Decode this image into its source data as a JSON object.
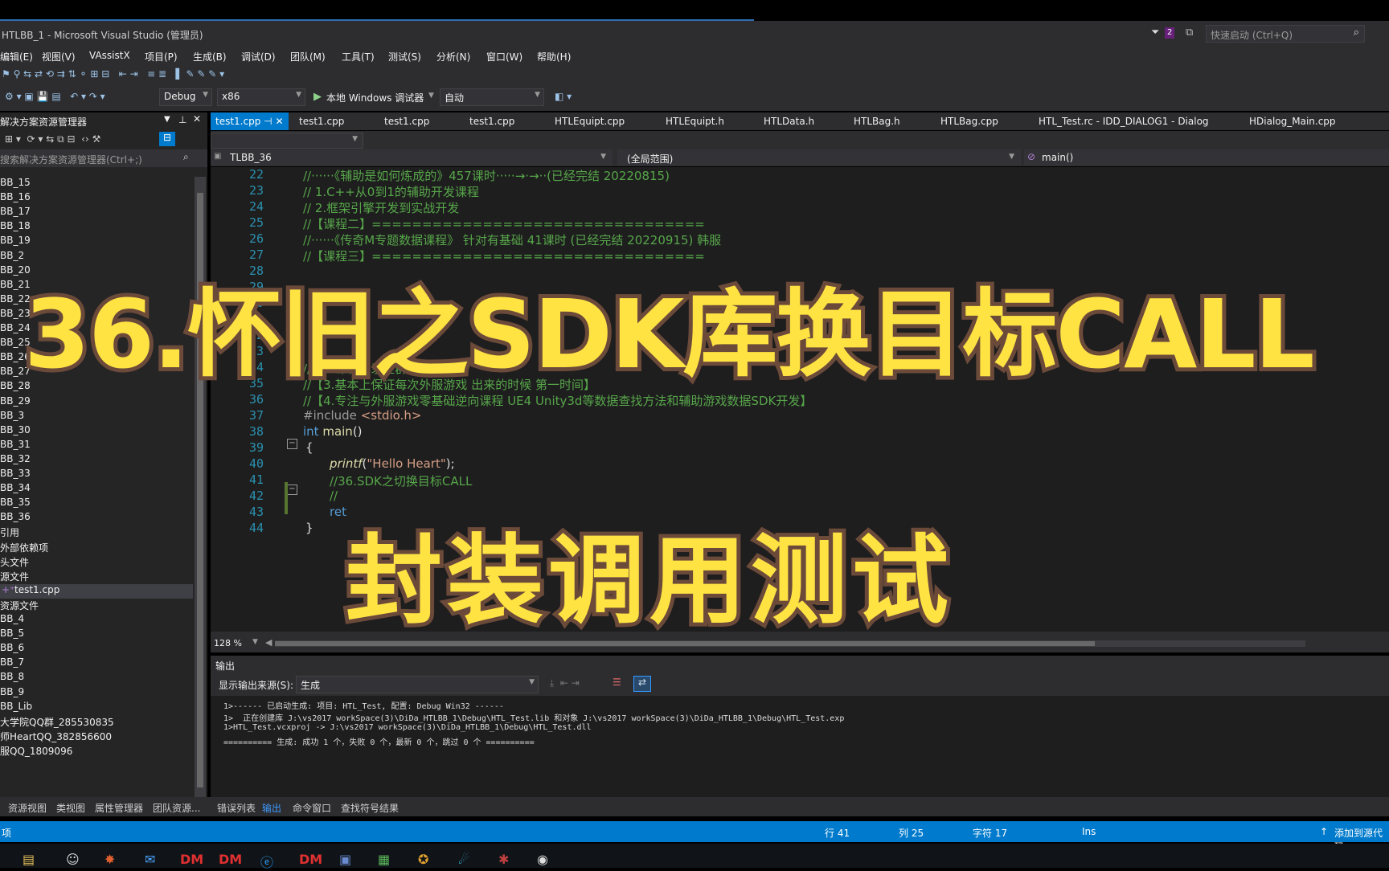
{
  "window": {
    "title": "HTLBB_1 - Microsoft Visual Studio (管理员)",
    "filter_count": "2",
    "quick_launch_placeholder": "快速启动 (Ctrl+Q)"
  },
  "menu": [
    "编辑(E)",
    "视图(V)",
    "VAssistX",
    "项目(P)",
    "生成(B)",
    "调试(D)",
    "团队(M)",
    "工具(T)",
    "测试(S)",
    "分析(N)",
    "窗口(W)",
    "帮助(H)"
  ],
  "toolbar": {
    "config": "Debug",
    "platform": "x86",
    "run_label": "本地 Windows 调试器",
    "run_mode": "自动"
  },
  "solution": {
    "header": "解决方案资源管理器",
    "search_placeholder": "搜索解决方案资源管理器(Ctrl+;)",
    "items": [
      "BB_15",
      "BB_16",
      "BB_17",
      "BB_18",
      "BB_19",
      "BB_2",
      "BB_20",
      "BB_21",
      "BB_22",
      "BB_23",
      "BB_24",
      "BB_25",
      "BB_26",
      "BB_27",
      "BB_28",
      "BB_29",
      "BB_3",
      "BB_30",
      "BB_31",
      "BB_32",
      "BB_33",
      "BB_34",
      "BB_35",
      "BB_36",
      "引用",
      "外部依赖项",
      "头文件",
      "源文件",
      "test1.cpp",
      "资源文件",
      "BB_4",
      "BB_5",
      "BB_6",
      "BB_7",
      "BB_8",
      "BB_9",
      "BB_Lib",
      "大学院QQ群_285530835",
      "师HeartQQ_382856600",
      "服QQ_1809096"
    ],
    "selected": "test1.cpp"
  },
  "editor_tabs": [
    "test1.cpp",
    "test1.cpp",
    "test1.cpp",
    "test1.cpp",
    "HTLEquipt.cpp",
    "HTLEquipt.h",
    "HTLData.h",
    "HTLBag.h",
    "HTLBag.cpp",
    "HTL_Test.rc - IDD_DIALOG1 - Dialog",
    "HDialog_Main.cpp"
  ],
  "nav": {
    "project": "TLBB_36",
    "scope": "(全局范围)",
    "member": "main()"
  },
  "code": {
    "line_numbers": [
      "22",
      "23",
      "24",
      "25",
      "26",
      "27",
      "28",
      "29",
      "30",
      "31",
      "32",
      "33",
      "34",
      "35",
      "36",
      "37",
      "38",
      "39",
      "40",
      "41",
      "42",
      "43",
      "44"
    ],
    "l22": "//······《辅助是如何炼成的》457课时·····→·→··(已经完结 20220815)",
    "l23": "// 1.C++从0到1的辅助开发课程",
    "l24": "// 2.框架引擎开发到实战开发",
    "l25": "//【课程二】=================================",
    "l26": "//······《传奇M专题数据课程》 针对有基础 41课时 (已经完结 20220915) 韩服",
    "l27": "//【课程三】=================================",
    "l34": "//【2.课程目录在群文件······】",
    "l35": "//【3.基本上保证每次外服游戏 出来的时候 第一时间】",
    "l36": "//【4.专注与外服游戏零基础逆向课程 UE4 Unity3d等数据查找方法和辅助游戏数据SDK开发】",
    "l37a": "#include",
    "l37b": " <stdio.h>",
    "l38a": "int",
    "l38b": " main",
    "l38c": "()",
    "l39": "{",
    "l40a": "printf",
    "l40b": "(",
    "l40c": "\"Hello Heart\"",
    "l40d": ");",
    "l41": "//36.SDK之切换目标CALL",
    "l42": "//",
    "l43": "ret",
    "l44": "}"
  },
  "overlay": {
    "title": "36.怀旧之SDK库换目标CALL",
    "subtitle": "封装调用测试"
  },
  "zoom": "128 %",
  "output": {
    "header": "输出",
    "source_label": "显示输出来源(S):",
    "source_value": "生成",
    "lines": [
      "1>------ 已启动生成: 项目: HTL_Test, 配置: Debug Win32 ------",
      "1>  正在创建库 J:\\vs2017 workSpace(3)\\DiDa_HTLBB_1\\Debug\\HTL_Test.lib 和对象 J:\\vs2017 workSpace(3)\\DiDa_HTLBB_1\\Debug\\HTL_Test.exp",
      "1>HTL_Test.vcxproj -> J:\\vs2017 workSpace(3)\\DiDa_HTLBB_1\\Debug\\HTL_Test.dll",
      "========== 生成: 成功 1 个，失败 0 个，最新 0 个，跳过 0 个 =========="
    ]
  },
  "bottom_tabs_left": [
    "资源视图",
    "类视图",
    "属性管理器",
    "团队资源..."
  ],
  "bottom_tabs_right": [
    "错误列表",
    "输出",
    "命令窗口",
    "查找符号结果"
  ],
  "status": {
    "left": "项",
    "row": "行 41",
    "col": "列 25",
    "char": "字符 17",
    "ins": "Ins",
    "right": "添加到源代码"
  },
  "taskbar_labels": [
    "DM",
    "DM",
    "DM"
  ]
}
